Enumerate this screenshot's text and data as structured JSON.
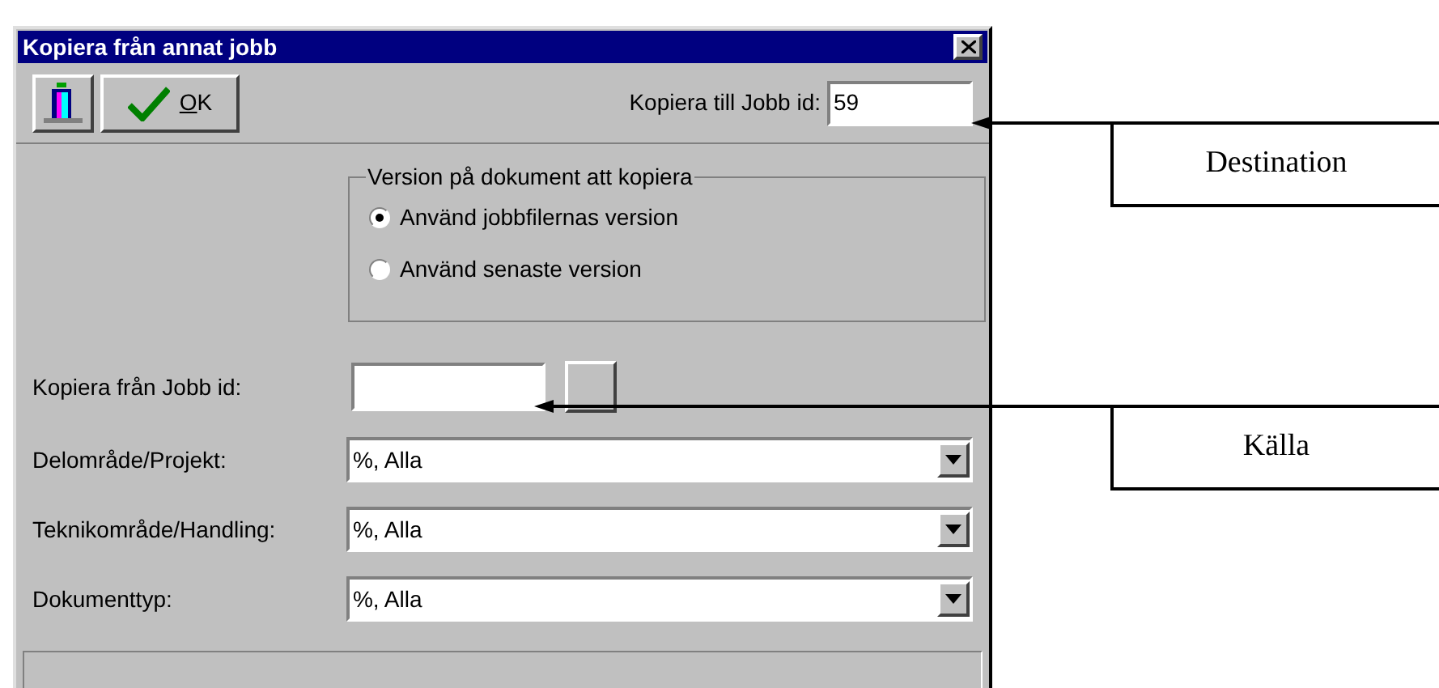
{
  "window": {
    "title": "Kopiera från annat jobb"
  },
  "toolbar": {
    "ok_button": {
      "label": "OK",
      "first_letter_underlined": true
    }
  },
  "destination": {
    "label": "Kopiera till Jobb id:",
    "value": "59"
  },
  "version_group": {
    "title": "Version på dokument att kopiera",
    "options": [
      {
        "label": "Använd jobbfilernas version",
        "selected": true
      },
      {
        "label": "Använd senaste version",
        "selected": false
      }
    ]
  },
  "source": {
    "label": "Kopiera från Jobb id:"
  },
  "filters": [
    {
      "label": "Delområde/Projekt:",
      "value": "%, Alla"
    },
    {
      "label": "Teknikområde/Handling:",
      "value": "%, Alla"
    },
    {
      "label": "Dokumenttyp:",
      "value": "%, Alla"
    }
  ],
  "callouts": [
    {
      "label": "Destination"
    },
    {
      "label": "Källa"
    }
  ]
}
